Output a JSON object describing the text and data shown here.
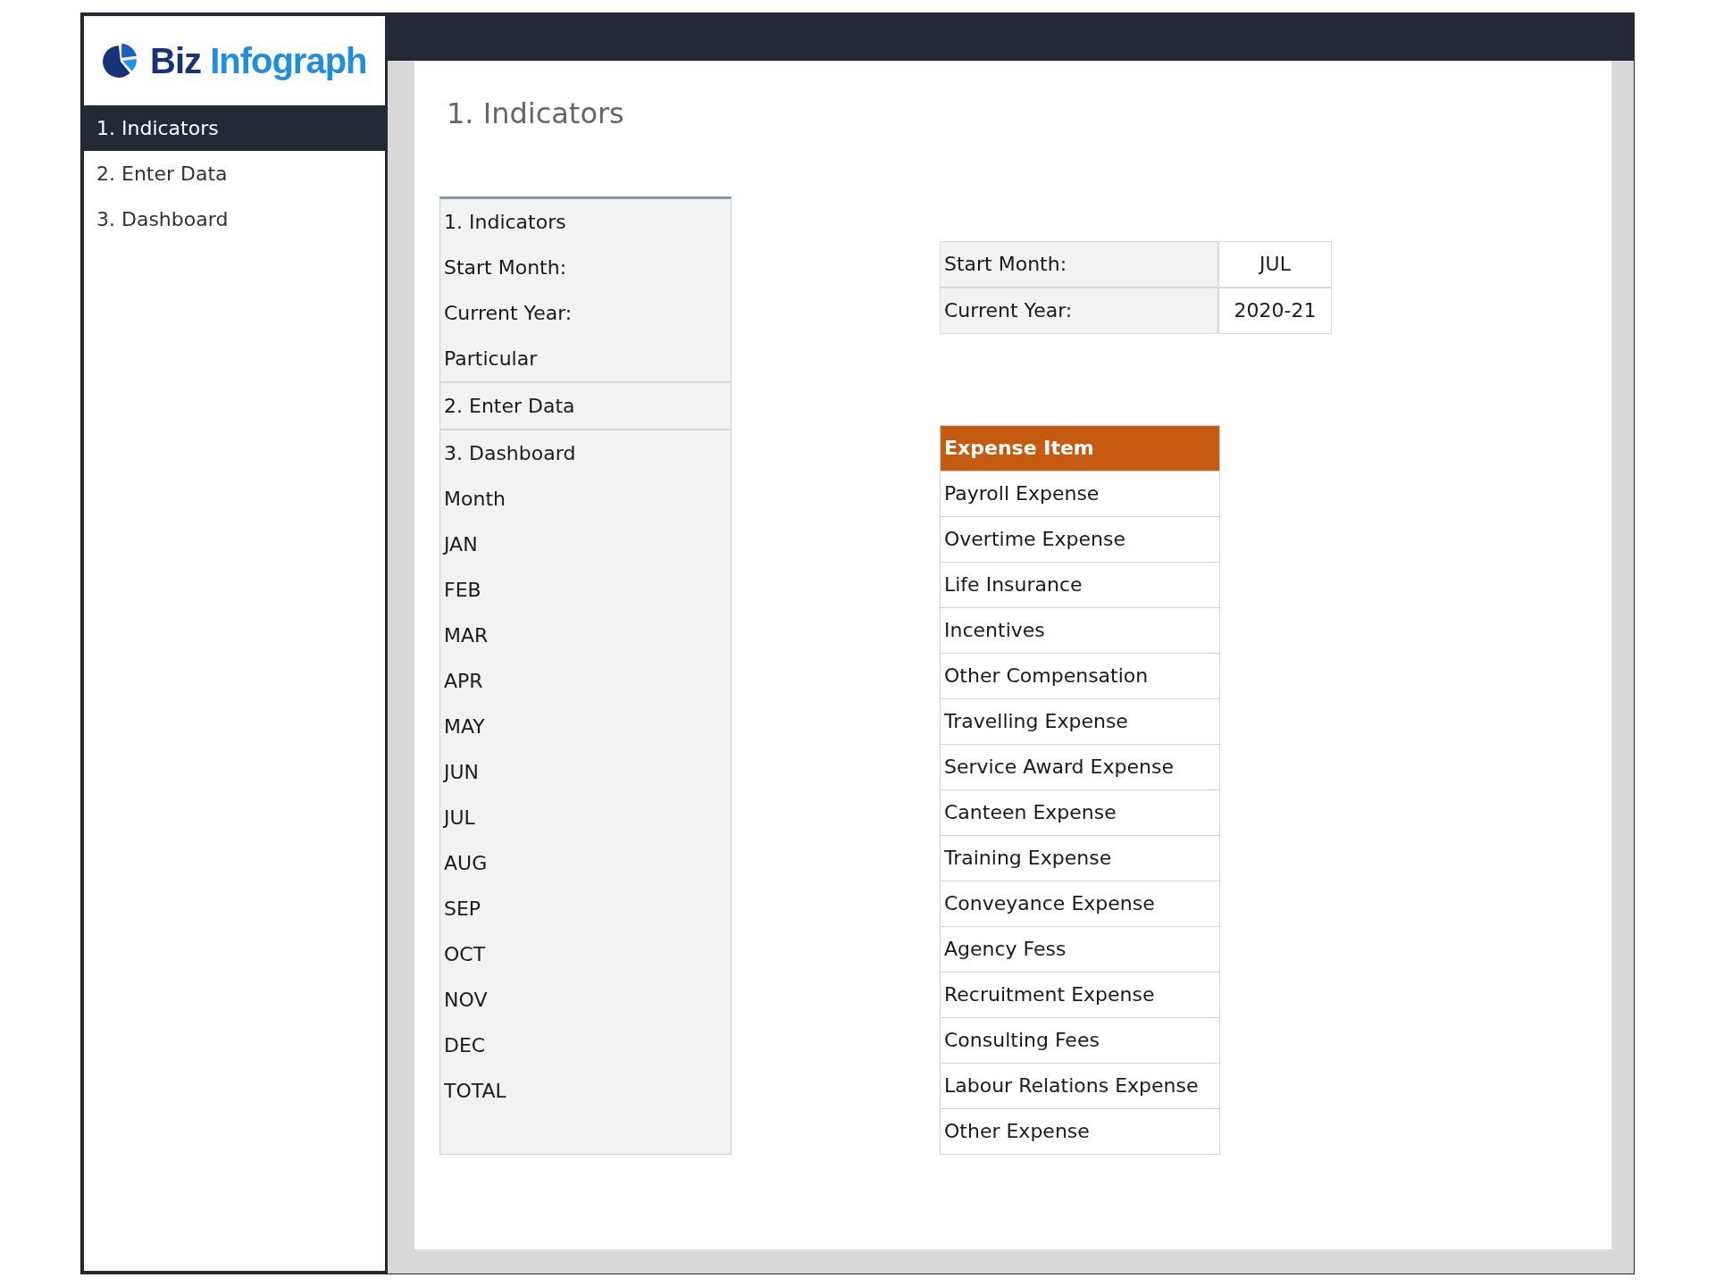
{
  "logo": {
    "word_1": "Biz",
    "word_2": "Infograph"
  },
  "sidebar": {
    "items": [
      {
        "label": "1. Indicators",
        "selected": true
      },
      {
        "label": "2. Enter Data",
        "selected": false
      },
      {
        "label": "3. Dashboard",
        "selected": false
      }
    ]
  },
  "page_title": "1. Indicators",
  "index_list": {
    "groups": [
      [
        "1. Indicators",
        "Start Month:",
        "Current Year:",
        "Particular"
      ],
      [
        "2. Enter Data"
      ],
      [
        "3. Dashboard",
        "Month",
        "JAN",
        "FEB",
        "MAR",
        "APR",
        "MAY",
        "JUN",
        "JUL",
        "AUG",
        "SEP",
        "OCT",
        "NOV",
        "DEC",
        "TOTAL"
      ]
    ]
  },
  "settings": [
    {
      "label": "Start Month:",
      "value": "JUL"
    },
    {
      "label": "Current Year:",
      "value": "2020-21"
    }
  ],
  "expense_table": {
    "header": "Expense Item",
    "rows": [
      "Payroll Expense",
      "Overtime Expense",
      "Life Insurance",
      "Incentives",
      "Other Compensation",
      "Travelling Expense",
      "Service Award Expense",
      "Canteen Expense",
      "Training Expense",
      "Conveyance Expense",
      "Agency Fess",
      "Recruitment Expense",
      "Consulting Fees",
      "Labour Relations Expense",
      "Other Expense"
    ]
  }
}
